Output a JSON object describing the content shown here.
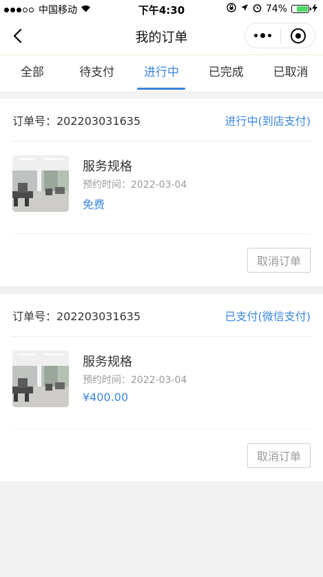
{
  "status_bar": {
    "carrier": "中国移动",
    "time": "下午4:30",
    "battery": "74%",
    "battery_level": 0.74
  },
  "nav": {
    "title": "我的订单"
  },
  "tabs": [
    {
      "label": "全部",
      "active": false
    },
    {
      "label": "待支付",
      "active": false
    },
    {
      "label": "进行中",
      "active": true
    },
    {
      "label": "已完成",
      "active": false
    },
    {
      "label": "已取消",
      "active": false
    }
  ],
  "orders": [
    {
      "order_no": "订单号：202203031635",
      "status": "进行中(到店支付)",
      "item_name": "服务规格",
      "time": "预约时间：2022-03-04",
      "price": "免费",
      "cancel_label": "取消订单"
    },
    {
      "order_no": "订单号：202203031635",
      "status": "已支付(微信支付)",
      "item_name": "服务规格",
      "time": "预约时间：2022-03-04",
      "price": "¥400.00",
      "cancel_label": "取消订单"
    }
  ],
  "colors": {
    "accent": "#3a86e0",
    "background": "#f2f2f2"
  }
}
